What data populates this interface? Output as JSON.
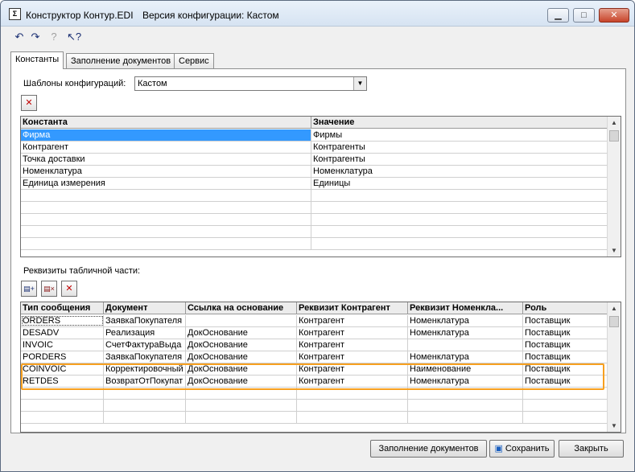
{
  "titlebar": {
    "app_title": "Конструктор Контур.EDI",
    "config_version": "Версия конфигурации: Кастом",
    "min_glyph": "▁",
    "max_glyph": "□",
    "close_glyph": "✕"
  },
  "toolbar": {
    "items": [
      {
        "icon": "undo-icon",
        "glyph": "↶"
      },
      {
        "icon": "redo-icon",
        "glyph": "↷"
      },
      {
        "icon": "help-icon",
        "glyph": "?"
      },
      {
        "icon": "whats-this-icon",
        "glyph": "↖?"
      }
    ]
  },
  "tabs": [
    {
      "label": "Константы",
      "active": true
    },
    {
      "label": "Заполнение документов",
      "active": false
    },
    {
      "label": "Сервис",
      "active": false
    }
  ],
  "config_templates": {
    "label": "Шаблоны конфигураций:",
    "selected": "Кастом",
    "arrow": "▼"
  },
  "delete_glyph": "✕",
  "constants_grid": {
    "headers": [
      "Константа",
      "Значение"
    ],
    "rows": [
      [
        "Фирма",
        "Фирмы"
      ],
      [
        "Контрагент",
        "Контрагенты"
      ],
      [
        "Точка доставки",
        "Контрагенты"
      ],
      [
        "Номенклатура",
        "Номенклатура"
      ],
      [
        "Единица измерения",
        "Единицы"
      ],
      [
        "",
        ""
      ],
      [
        "",
        ""
      ],
      [
        "",
        ""
      ],
      [
        "",
        ""
      ],
      [
        "",
        ""
      ]
    ],
    "selected_row": 0
  },
  "table_part": {
    "label": "Реквизиты табличной части:",
    "buttons": [
      {
        "icon": "add-row-icon",
        "glyph": "▤+"
      },
      {
        "icon": "delete-row-icon",
        "glyph": "▤×"
      },
      {
        "icon": "delete-icon",
        "glyph": "✕"
      }
    ]
  },
  "requisites_grid": {
    "headers": [
      "Тип сообщения",
      "Документ",
      "Ссылка на основание",
      "Реквизит Контрагент",
      "Реквизит Номенкла...",
      "Роль"
    ],
    "rows": [
      [
        "ORDERS",
        "ЗаявкаПокупателя",
        "",
        "Контрагент",
        "Номенклатура",
        "Поставщик"
      ],
      [
        "DESADV",
        "Реализация",
        "ДокОснование",
        "Контрагент",
        "Номенклатура",
        "Поставщик"
      ],
      [
        "INVOIC",
        "СчетФактураВыда",
        "ДокОснование",
        "Контрагент",
        "",
        "Поставщик"
      ],
      [
        "PORDERS",
        "ЗаявкаПокупателя",
        "ДокОснование",
        "Контрагент",
        "Номенклатура",
        "Поставщик"
      ],
      [
        "COINVOIC",
        "Корректировочный",
        "ДокОснование",
        "Контрагент",
        "Наименование",
        "Поставщик"
      ],
      [
        "RETDES",
        "ВозвратОтПокупат",
        "ДокОснование",
        "Контрагент",
        "Номенклатура",
        "Поставщик"
      ],
      [
        "",
        "",
        "",
        "",
        "",
        ""
      ],
      [
        "",
        "",
        "",
        "",
        "",
        ""
      ],
      [
        "",
        "",
        "",
        "",
        "",
        ""
      ]
    ]
  },
  "footer": {
    "fill_docs_label": "Заполнение документов",
    "save_label": "Сохранить",
    "close_label": "Закрыть"
  },
  "colors": {
    "selection": "#3399ff",
    "highlight_frame": "#f7a020"
  }
}
